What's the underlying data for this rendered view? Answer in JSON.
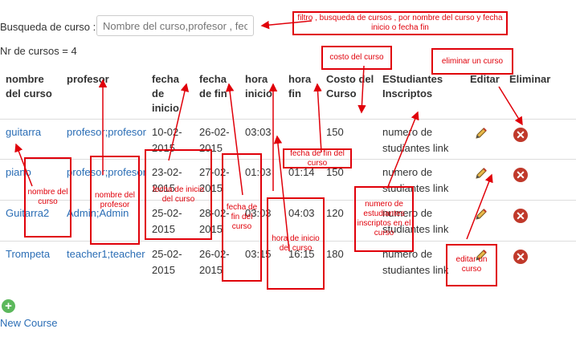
{
  "search": {
    "label": "Busqueda de curso :",
    "placeholder": "Nombre del curso,profesor , fech"
  },
  "course_count": "Nr de cursos = 4",
  "table": {
    "headers": [
      "nombre del curso",
      "profesor",
      "fecha de inicio",
      "fecha de fin",
      "hora inicio",
      "hora fin",
      "Costo del Curso",
      "EStudiantes Inscriptos",
      "Editar",
      "Eliminar"
    ],
    "rows": [
      {
        "nombre": "guitarra",
        "profesor": "profesor;profesor",
        "inicio": "10-02-2015",
        "fin": "26-02-2015",
        "hora_inicio": "03:03",
        "hora_fin": "",
        "costo": "150",
        "estudiantes": "numero de studiantes link"
      },
      {
        "nombre": "piano",
        "profesor": "profesor;profesor",
        "inicio": "23-02-2015",
        "fin": "27-02-2015",
        "hora_inicio": "01:03",
        "hora_fin": "01:14",
        "costo": "150",
        "estudiantes": "numero de studiantes link"
      },
      {
        "nombre": "Guitarra2",
        "profesor": "Admin;Admin",
        "inicio": "25-02-2015",
        "fin": "28-02-2015",
        "hora_inicio": "03:03",
        "hora_fin": "04:03",
        "costo": "120",
        "estudiantes": "numero de studiantes link"
      },
      {
        "nombre": "Trompeta",
        "profesor": "teacher1;teacher",
        "inicio": "25-02-2015",
        "fin": "26-02-2015",
        "hora_inicio": "03:15",
        "hora_fin": "16:15",
        "costo": "180",
        "estudiantes": "numero de studiantes link"
      }
    ]
  },
  "new_course_label": "New Course",
  "icons": {
    "edit": "pencil-icon",
    "delete": "delete-x-icon",
    "add": "plus-circle-icon"
  },
  "annotations": {
    "filtro": "filtro , busqueda de cursos , por nombre del curso y fecha inicio o fecha fin",
    "costo": "costo del curso",
    "eliminar": "eliminar un curso",
    "nombre": "nombre del curso",
    "profesor": "nombre del profesor",
    "fecha_inicio": "fecha de inicio del curso",
    "fecha_fin": "fecha de fin del curso",
    "hora_inicio": "hora de inicio del curso",
    "hora_fin": "fecha de fin del curso",
    "estudiantes": "numero de estudiantes inscriptos en el curso",
    "editar": "editar un curso"
  },
  "colors": {
    "link": "#2a6db5",
    "annotation": "#e0000a",
    "delete": "#c0392b",
    "add": "#5cb85c"
  }
}
